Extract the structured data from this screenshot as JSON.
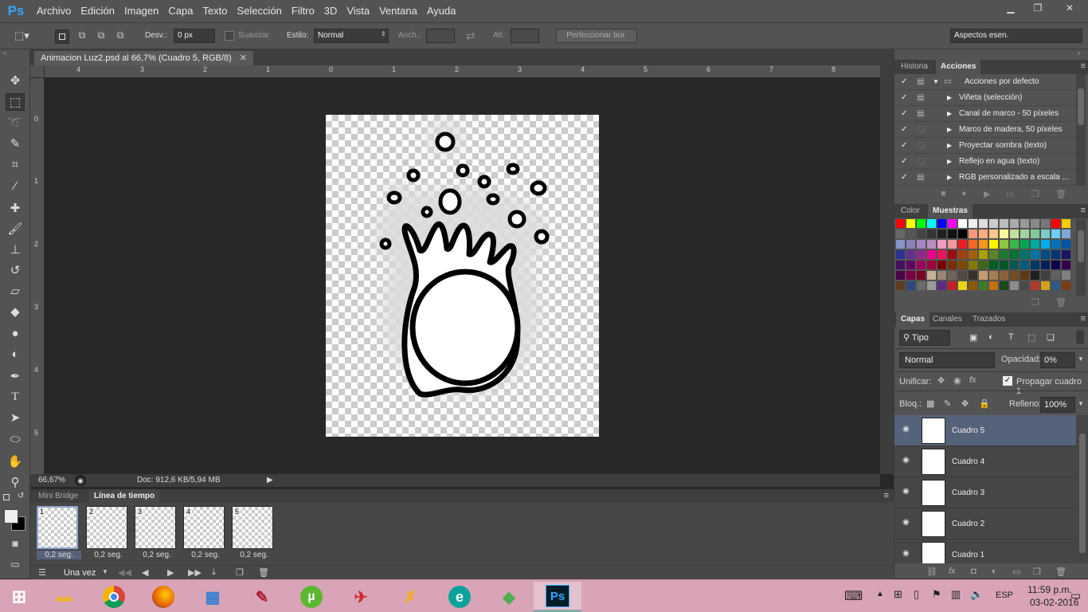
{
  "app": {
    "logo": "Ps"
  },
  "menu": [
    "Archivo",
    "Edición",
    "Imagen",
    "Capa",
    "Texto",
    "Selección",
    "Filtro",
    "3D",
    "Vista",
    "Ventana",
    "Ayuda"
  ],
  "options": {
    "desv_label": "Desv.:",
    "desv_value": "0 px",
    "suavizar": "Suavizar",
    "estilo_label": "Estilo:",
    "estilo_value": "Normal",
    "anch_label": "Anch.:",
    "alt_label": "Alt.:",
    "refine_button": "Perfeccionar bor.",
    "workspace": "Aspectos esen."
  },
  "document": {
    "tab_title": "Animacion Luz2.psd al 66,7% (Cuadro 5, RGB/8)",
    "zoom": "66,67%",
    "doc_info": "Doc: 912,6 KB/5,94 MB"
  },
  "rulers": {
    "top": [
      "4",
      "3",
      "2",
      "1",
      "0",
      "1",
      "2",
      "3",
      "4",
      "5",
      "6",
      "7",
      "8"
    ],
    "left": [
      "0",
      "1",
      "2",
      "3",
      "4",
      "5"
    ]
  },
  "timeline": {
    "tabs": [
      "Mini Bridge",
      "Línea de tiempo"
    ],
    "frames": [
      {
        "num": "1",
        "duration": "0,2 seg."
      },
      {
        "num": "2",
        "duration": "0,2 seg."
      },
      {
        "num": "3",
        "duration": "0,2 seg."
      },
      {
        "num": "4",
        "duration": "0,2 seg."
      },
      {
        "num": "5",
        "duration": "0,2 seg."
      }
    ],
    "loop": "Una vez"
  },
  "panels": {
    "history_tab": "Historia",
    "actions_tab": "Acciones",
    "actions": [
      {
        "label": "Acciones por defecto",
        "folder": true
      },
      {
        "label": "Viñeta (selección)"
      },
      {
        "label": "Canal de marco - 50 píxeles"
      },
      {
        "label": "Marco de madera, 50 píxeles"
      },
      {
        "label": "Proyectar sombra (texto)"
      },
      {
        "label": "Reflejo en agua (texto)"
      },
      {
        "label": "RGB personalizado a escala ..."
      }
    ],
    "color_tab": "Color",
    "swatches_tab": "Muestras",
    "layers_tabs": [
      "Capas",
      "Canales",
      "Trazados"
    ],
    "kind_filter": "Tipo",
    "blend_mode": "Normal",
    "opacity_label": "Opacidad:",
    "opacity_value": "0%",
    "unify_label": "Unificar:",
    "propagate": "Propagar cuadro 1",
    "lock_label": "Bloq.:",
    "fill_label": "Relleno:",
    "fill_value": "100%",
    "layers": [
      "Cuadro 5",
      "Cuadro 4",
      "Cuadro 3",
      "Cuadro 2",
      "Cuadro 1"
    ]
  },
  "taskbar": {
    "time": "11:59 p.m.",
    "date": "03-02-2016",
    "lang": "ESP",
    "ps_label": "Ps"
  },
  "swatch_colors": [
    "#ff0000",
    "#ffff00",
    "#00ff00",
    "#00ffff",
    "#0000ff",
    "#ff00ff",
    "#ffffff",
    "#eeeeee",
    "#dddddd",
    "#cccccc",
    "#bbbbbb",
    "#aaaaaa",
    "#999999",
    "#888888",
    "#777777",
    "#ff0000",
    "#ffcc00",
    "#666666",
    "#555555",
    "#444444",
    "#333333",
    "#222222",
    "#111111",
    "#000000",
    "#f7977a",
    "#f9ad81",
    "#fdc68a",
    "#fff79a",
    "#c4df9b",
    "#a2d39c",
    "#82ca9d",
    "#7bcdc8",
    "#6ecff6",
    "#7ea7d8",
    "#8493ca",
    "#8882be",
    "#a187be",
    "#bc8dbf",
    "#f49ac2",
    "#f6989d",
    "#ed1c24",
    "#f26522",
    "#f7941d",
    "#fff200",
    "#8dc63f",
    "#39b54a",
    "#00a651",
    "#00a99d",
    "#00aeef",
    "#0072bc",
    "#0054a6",
    "#2e3192",
    "#662d91",
    "#92278f",
    "#ec008c",
    "#ed145b",
    "#9e0b0f",
    "#a0410d",
    "#a36209",
    "#aba000",
    "#598527",
    "#1a7b30",
    "#007236",
    "#00746b",
    "#0076a3",
    "#004b80",
    "#003471",
    "#1b1464",
    "#440e62",
    "#630460",
    "#9e005d",
    "#9e0039",
    "#790000",
    "#7b2e00",
    "#7d4900",
    "#827b00",
    "#406618",
    "#005e20",
    "#005826",
    "#005952",
    "#005b7f",
    "#003663",
    "#002157",
    "#0d004c",
    "#32004b",
    "#4b0049",
    "#7b0046",
    "#7a0026",
    "#c7b299",
    "#998675",
    "#736357",
    "#534741",
    "#37302d",
    "#c69c6d",
    "#a67c52",
    "#8c6239",
    "#754c24",
    "#603913",
    "#1e1e1e",
    "#404040",
    "#606060",
    "#808080",
    "#5f3b1c",
    "#2b4b7d",
    "#6a6a6a",
    "#9c9c9c",
    "#5a2d82",
    "#c31f26",
    "#e8d315",
    "#8b5a00",
    "#3d7a2a",
    "#c46f10",
    "#1a4a1a",
    "#8c8c8c",
    "#4a4a4a",
    "#b03a2e",
    "#d4a017",
    "#2e5a88",
    "#7a3c12"
  ]
}
